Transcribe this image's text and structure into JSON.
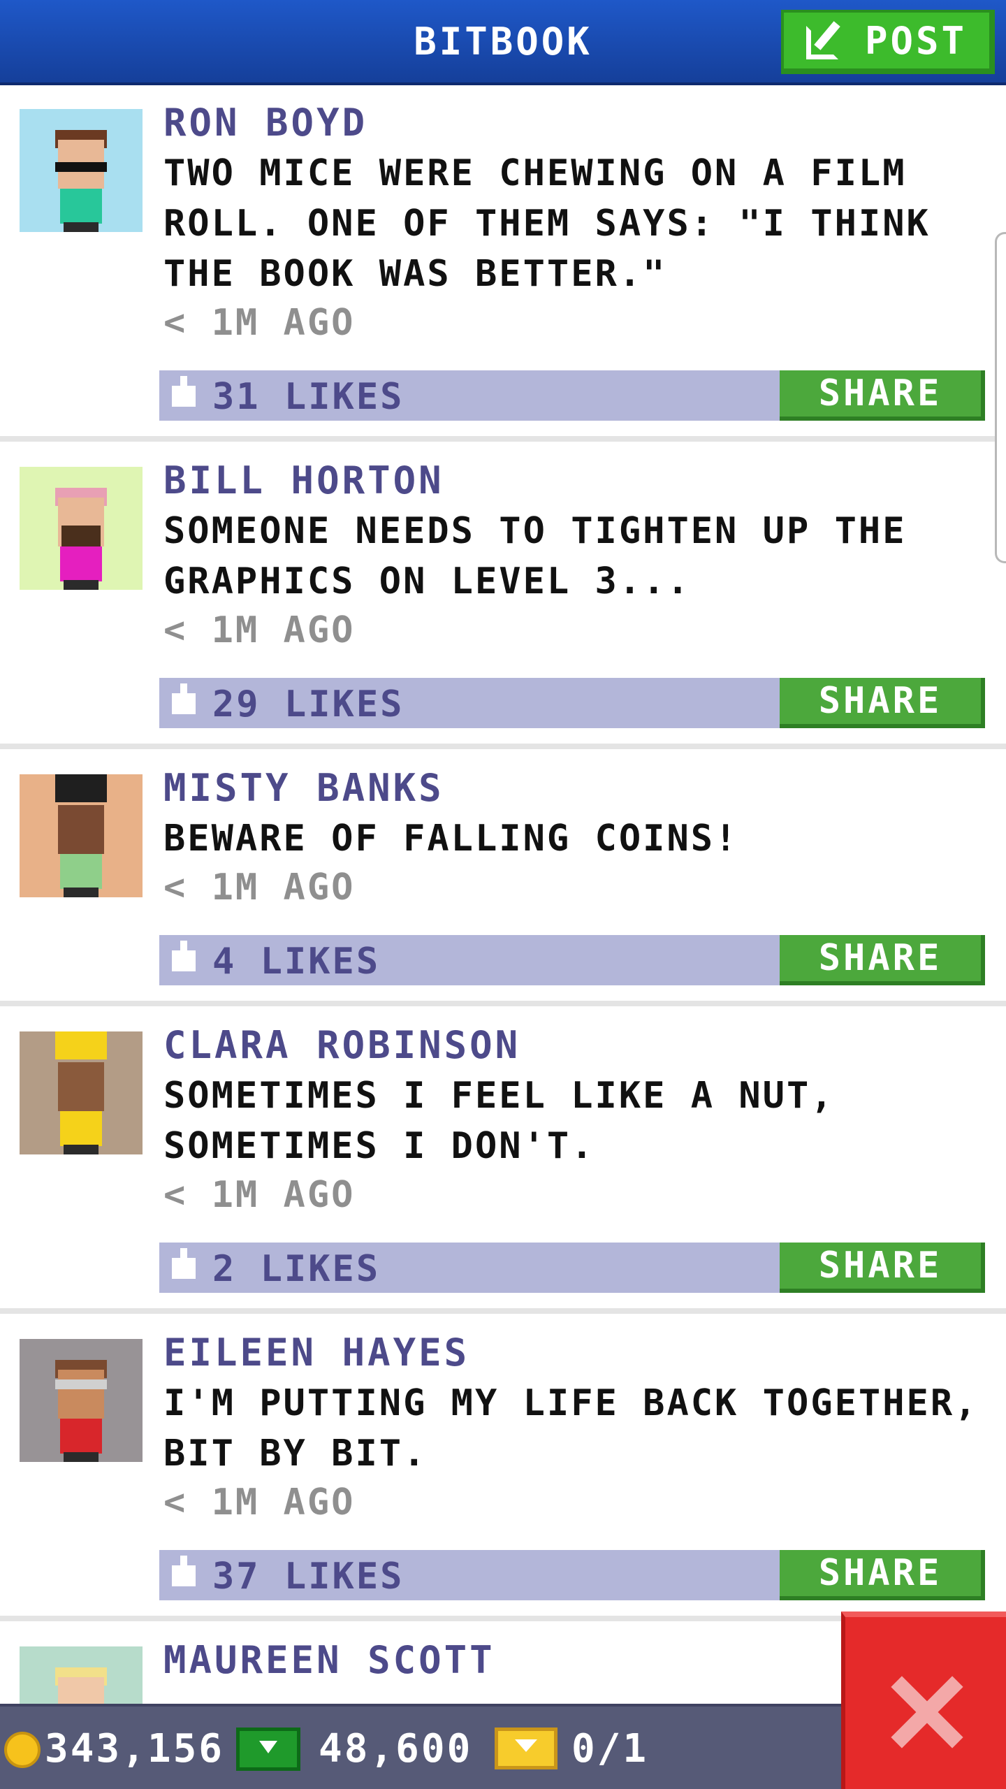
{
  "header": {
    "title": "BITBOOK",
    "post_label": "POST",
    "colors": {
      "bar": "#1f58c8",
      "post_button": "#3dbb2c"
    }
  },
  "posts": [
    {
      "author": "RON BOYD",
      "message": "TWO MICE WERE CHEWING ON A FILM ROLL. ONE OF THEM SAYS: \"I THINK THE BOOK WAS BETTER.\"",
      "time": "< 1M AGO",
      "likes": "31 LIKES",
      "share_label": "SHARE",
      "avatar_bg": "#a9dff0"
    },
    {
      "author": "BILL HORTON",
      "message": "SOMEONE NEEDS TO TIGHTEN UP THE GRAPHICS ON LEVEL 3...",
      "time": "< 1M AGO",
      "likes": "29 LIKES",
      "share_label": "SHARE",
      "avatar_bg": "#dff5b3"
    },
    {
      "author": "MISTY BANKS",
      "message": "BEWARE OF FALLING COINS!",
      "time": "< 1M AGO",
      "likes": "4 LIKES",
      "share_label": "SHARE",
      "avatar_bg": "#e8b188"
    },
    {
      "author": "CLARA ROBINSON",
      "message": "SOMETIMES I FEEL LIKE A NUT, SOMETIMES I DON'T.",
      "time": "< 1M AGO",
      "likes": "2 LIKES",
      "share_label": "SHARE",
      "avatar_bg": "#b39c86"
    },
    {
      "author": "EILEEN HAYES",
      "message": "I'M PUTTING MY LIFE BACK TOGETHER, BIT BY BIT.",
      "time": "< 1M AGO",
      "likes": "37 LIKES",
      "share_label": "SHARE",
      "avatar_bg": "#989396"
    },
    {
      "author": "MAUREEN SCOTT",
      "avatar_bg": "#b7dccb"
    }
  ],
  "footer": {
    "coins": "343,156",
    "bux": "48,600",
    "tickets": "0/1",
    "icons": [
      "coin-icon",
      "bux-icon",
      "ticket-icon"
    ]
  },
  "close_button": {
    "icon": "close-icon",
    "color": "#e52a2a"
  }
}
